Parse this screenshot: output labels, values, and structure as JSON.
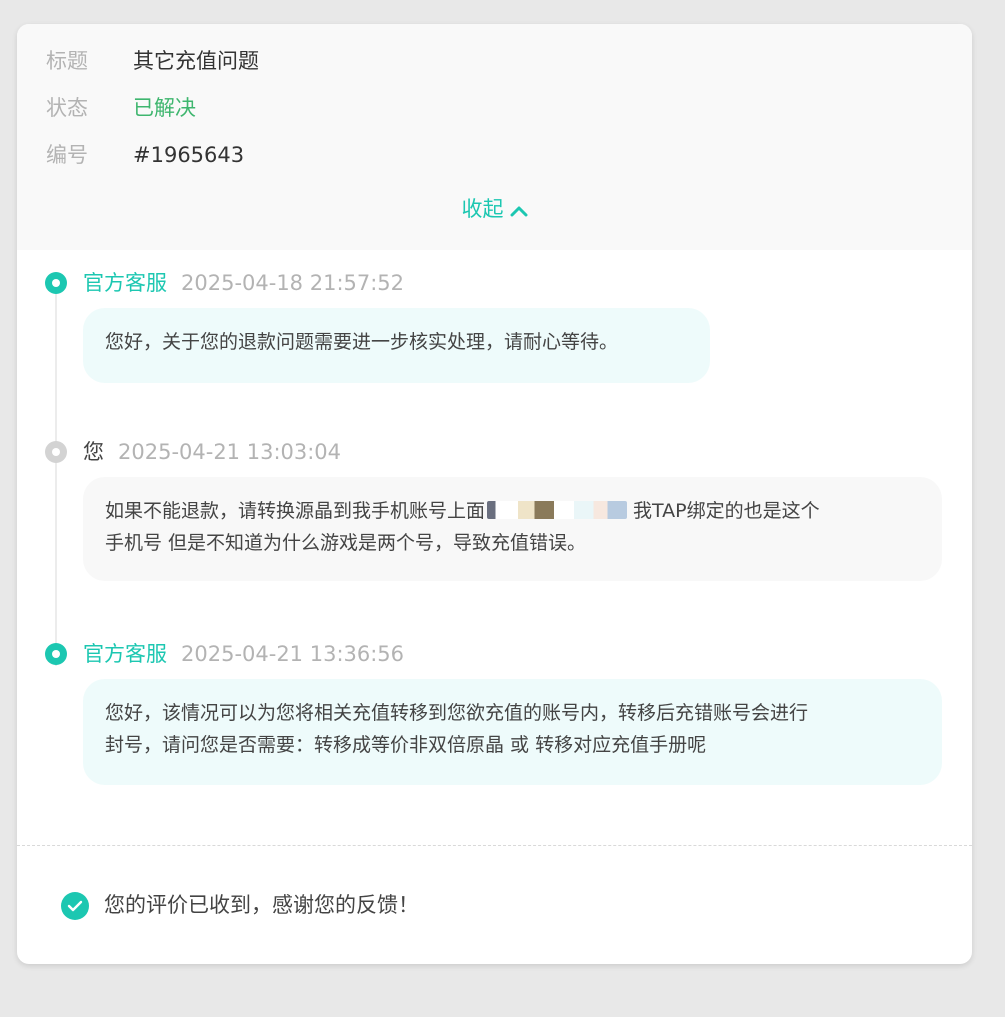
{
  "ticket": {
    "fields": [
      {
        "label": "标题",
        "value": "其它充值问题"
      },
      {
        "label": "状态",
        "value": "已解决"
      },
      {
        "label": "编号",
        "value": "#1965643"
      }
    ],
    "collapse_label": "收起"
  },
  "messages": [
    {
      "sender": "官方客服",
      "time": "2025-04-18 21:57:52",
      "lines": [
        "您好，关于您的退款问题需要进一步核实处理，请耐心等待。"
      ]
    },
    {
      "sender": "您",
      "time": "2025-04-21 13:03:04",
      "line1_before": "如果不能退款，请转换源晶到我手机账号上面",
      "line1_after": "我TAP绑定的也是这个",
      "line2": "手机号 但是不知道为什么游戏是两个号，导致充值错误。"
    },
    {
      "sender": "官方客服",
      "time": "2025-04-21 13:36:56",
      "lines": [
        "您好，该情况可以为您将相关充值转移到您欲充值的账号内，转移后充错账号会进行",
        "封号，请问您是否需要：转移成等价非双倍原晶 或 转移对应充值手册呢"
      ]
    }
  ],
  "feedback": {
    "text": "您的评价已收到，感谢您的反馈！"
  },
  "colors": {
    "accent": "#1cc7b1",
    "status_green": "#3fb66f",
    "muted": "#b3b3b3"
  },
  "icons": {
    "collapse": "chevron-up-icon",
    "feedback": "check-circle-icon"
  }
}
